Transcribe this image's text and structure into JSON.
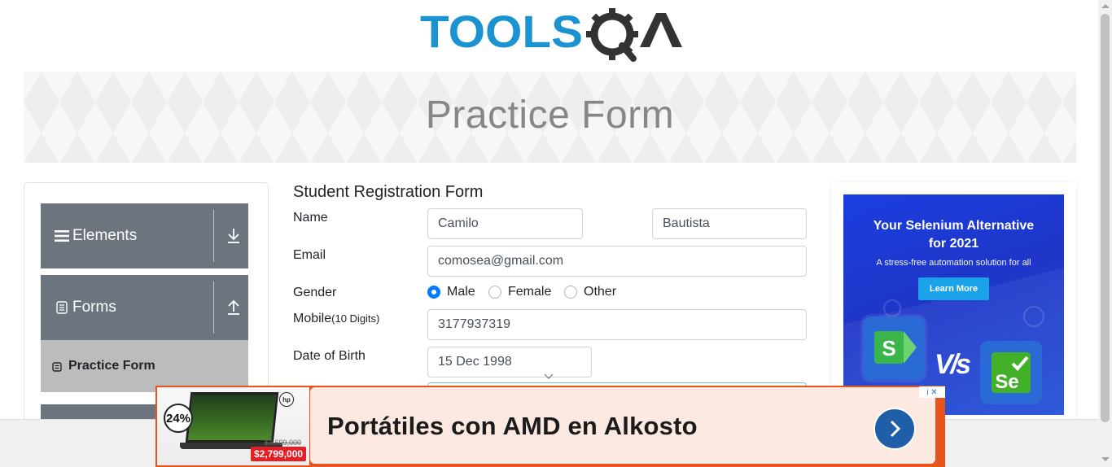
{
  "header": {
    "logo_text": "TOOLSQA"
  },
  "banner": {
    "title": "Practice Form"
  },
  "sidebar": {
    "groups": [
      {
        "label": "Elements",
        "icon": "hamburger-icon",
        "arrow": "download-arrow-icon"
      },
      {
        "label": "Forms",
        "icon": "document-icon",
        "arrow": "upload-arrow-icon"
      }
    ],
    "active_item": {
      "label": "Practice Form",
      "icon": "form-icon"
    }
  },
  "form": {
    "title": "Student Registration Form",
    "name_label": "Name",
    "first_name": "Camilo",
    "last_name": "Bautista",
    "email_label": "Email",
    "email": "comosea@gmail.com",
    "gender_label": "Gender",
    "genders": [
      "Male",
      "Female",
      "Other"
    ],
    "gender_selected": "Male",
    "mobile_label": "Mobile",
    "mobile_hint": "(10 Digits)",
    "mobile": "3177937319",
    "dob_label": "Date of Birth",
    "dob": "15 Dec 1998"
  },
  "right_ad": {
    "headline_1": "Your Selenium Alternative",
    "headline_2": "for 2021",
    "subtext": "A stress-free automation solution for all",
    "button": "Learn More",
    "vs": "V/s",
    "logo_left": "S",
    "logo_right": "Se"
  },
  "bottom_ad": {
    "text": "Portátiles con AMD en Alkosto",
    "discount": "24%",
    "price_old": "$3,699,000",
    "price": "$2,799,000",
    "brand": "hp",
    "adchoices": "i ✕"
  },
  "colors": {
    "accent_blue": "#007bff",
    "nav_gray": "#6c757d",
    "ad_orange": "#e8541c",
    "logo_blue": "#1b93d1"
  }
}
